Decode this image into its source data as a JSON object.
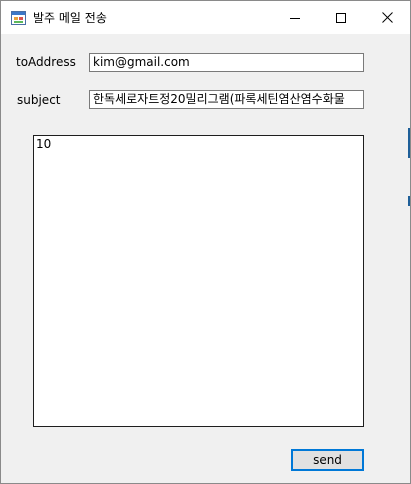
{
  "window": {
    "title": "발주 메일 전송",
    "icon": "form-app-icon",
    "controls": {
      "minimize_icon": "minimize-icon",
      "maximize_icon": "maximize-icon",
      "close_icon": "close-icon"
    }
  },
  "form": {
    "to_address": {
      "label": "toAddress",
      "value": "kim@gmail.com"
    },
    "subject": {
      "label": "subject",
      "value": "한독세로자트정20밀리그램(파록세틴염산염수화물"
    },
    "body": {
      "value": "10"
    },
    "send_label": "send"
  },
  "colors": {
    "window_bg": "#f0f0f0",
    "titlebar_bg": "#ffffff",
    "focus_accent": "#0078d7"
  }
}
